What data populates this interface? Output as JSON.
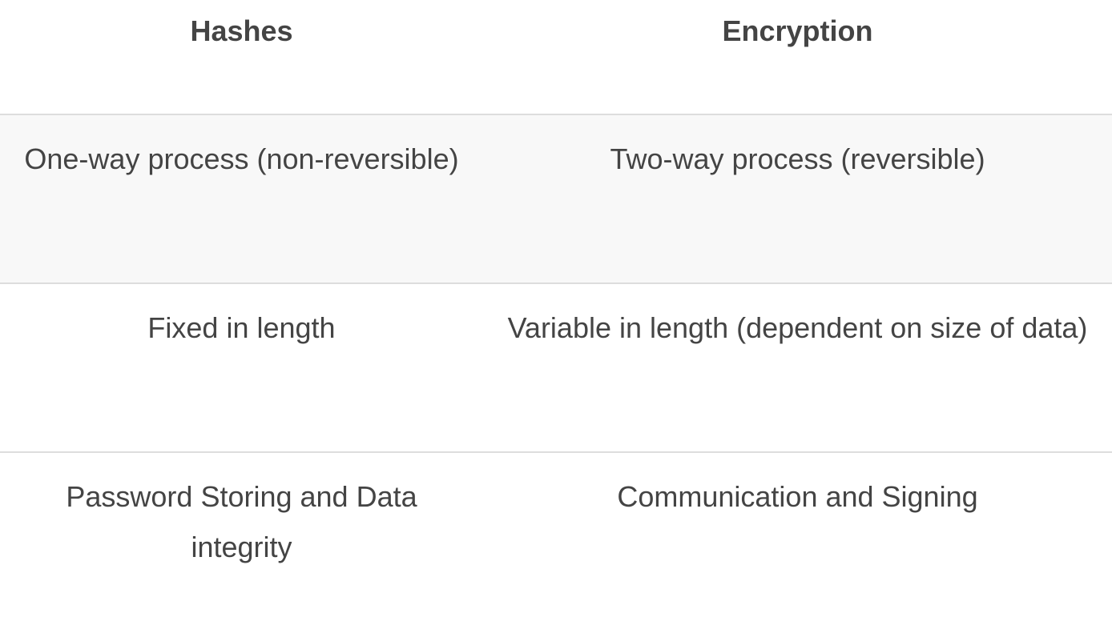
{
  "table": {
    "headers": {
      "hashes": "Hashes",
      "encryption": "Encryption"
    },
    "rows": [
      {
        "hashes": "One-way process (non-reversible)",
        "encryption": "Two-way process (reversible)"
      },
      {
        "hashes": "Fixed in length",
        "encryption": "Variable in length (dependent on size of data)"
      },
      {
        "hashes": "Password Storing and Data integrity",
        "encryption": "Communication and Signing"
      }
    ]
  },
  "colors": {
    "text": "#444444",
    "row_stripe": "#f8f8f8",
    "divider": "#dddddd"
  }
}
